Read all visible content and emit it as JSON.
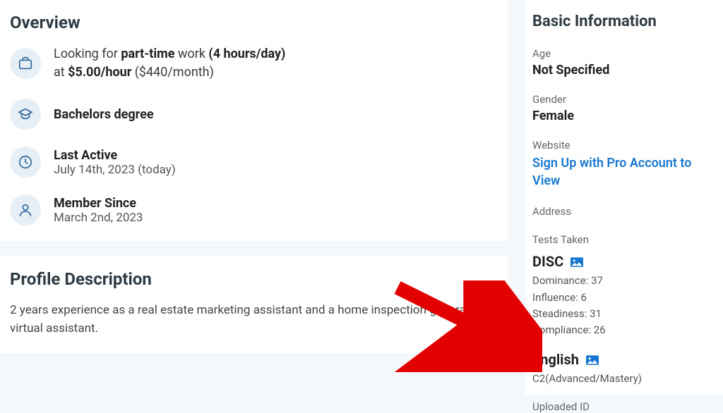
{
  "overview": {
    "title": "Overview",
    "looking": {
      "prefix": "Looking for ",
      "emphasis": "part-time",
      "middle": " work ",
      "hours": "(4 hours/day)",
      "at_prefix": "at ",
      "rate": "$5.00/hour",
      "rate_suffix": " ($440/month)"
    },
    "education": "Bachelors degree",
    "last_active_label": "Last Active",
    "last_active_value": "July 14th, 2023 (today)",
    "member_since_label": "Member Since",
    "member_since_value": "March 2nd, 2023"
  },
  "profile": {
    "title": "Profile Description",
    "body": "2 years experience as a real estate marketing assistant and a home inspection general virtual assistant."
  },
  "basic": {
    "title": "Basic Information",
    "age_label": "Age",
    "age_value": "Not Specified",
    "gender_label": "Gender",
    "gender_value": "Female",
    "website_label": "Website",
    "website_link": "Sign Up with Pro Account to View",
    "address_label": "Address",
    "tests_label": "Tests Taken",
    "disc": {
      "name": "DISC",
      "dominance": "Dominance: 37",
      "influence": "Influence: 6",
      "steadiness": "Steadiness: 31",
      "compliance": "Compliance: 26"
    },
    "english": {
      "name": "English",
      "level": "C2(Advanced/Mastery)"
    },
    "uploaded_id_label": "Uploaded ID"
  }
}
